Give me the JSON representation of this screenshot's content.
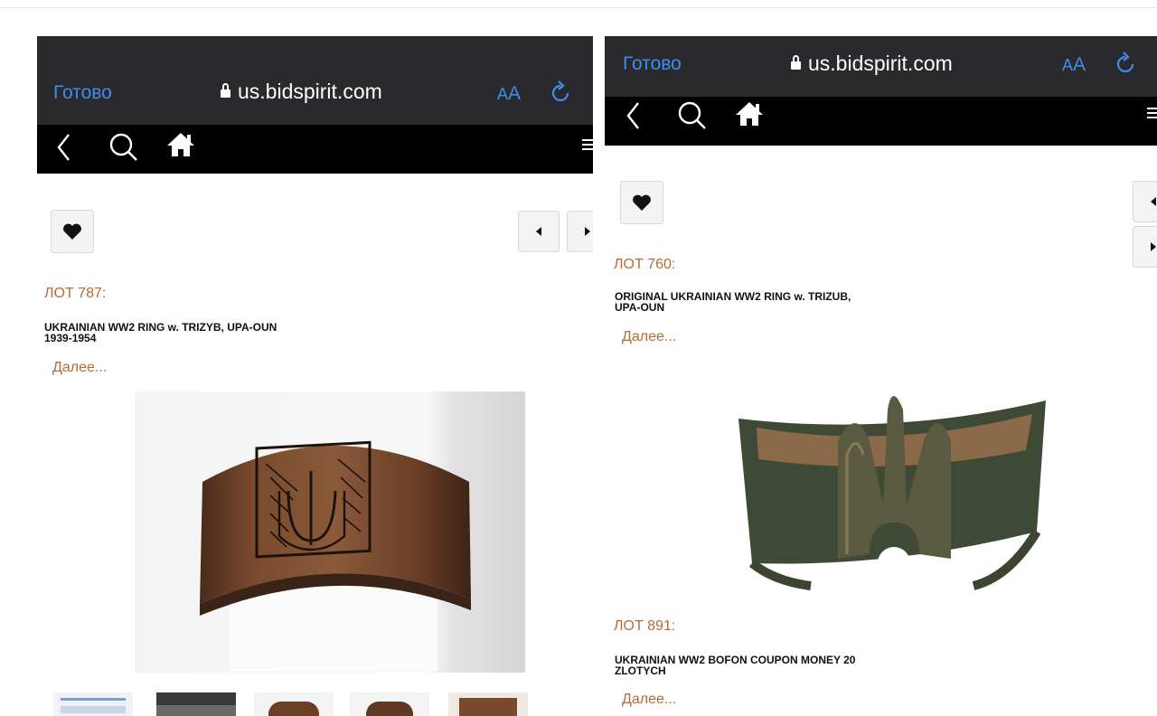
{
  "left": {
    "done_label": "Готово",
    "url": "us.bidspirit.com",
    "text_size_small": "A",
    "text_size_big": "A",
    "lot_label": "ЛОТ 787:",
    "title_line1": "UKRAINIAN WW2 RING w. TRIZYB, UPA-OUN",
    "title_line2": "1939-1954",
    "more_label": "Далее..."
  },
  "right": {
    "done_label": "Готово",
    "url": "us.bidspirit.com",
    "text_size_small": "A",
    "text_size_big": "A",
    "lot_label": "ЛОТ 760:",
    "title_line1": "ORIGINAL UKRAINIAN WW2 RING w. TRIZUB,",
    "title_line2": "UPA-OUN",
    "more_label": "Далее...",
    "lot2_label": "ЛОТ 891:",
    "title2_line1": "UKRAINIAN WW2 BOFON COUPON MONEY 20",
    "title2_line2": "ZLOTYCH",
    "more2_label": "Далее..."
  },
  "colors": {
    "accent_link": "#3d8ef0",
    "lot_orange": "#b56a35",
    "safari_bar": "#2a2a2c",
    "nav_bar": "#000000"
  },
  "icons": [
    "lock-icon",
    "reload-icon",
    "back-icon",
    "search-icon",
    "home-icon",
    "menu-icon",
    "heart-icon",
    "prev-arrow-icon",
    "next-arrow-icon"
  ]
}
